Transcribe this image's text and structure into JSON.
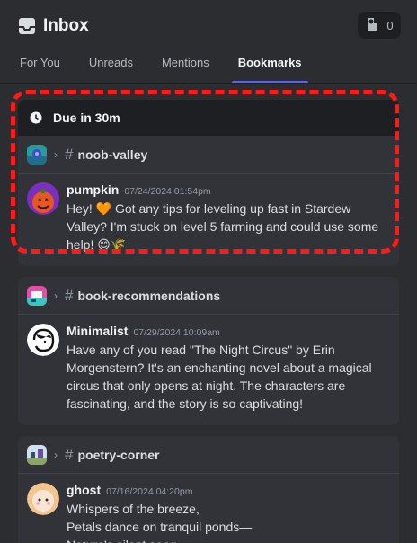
{
  "header": {
    "title": "Inbox",
    "mentions_count": "0"
  },
  "tabs": [
    {
      "label": "For You",
      "active": false
    },
    {
      "label": "Unreads",
      "active": false
    },
    {
      "label": "Mentions",
      "active": false
    },
    {
      "label": "Bookmarks",
      "active": true
    }
  ],
  "bookmarks": [
    {
      "due_label": "Due in 30m",
      "channel": "noob-valley",
      "author": "pumpkin",
      "timestamp": "07/24/2024 01:54pm",
      "text": "Hey! 🧡 Got any tips for leveling up fast in Stardew Valley? I'm stuck on level 5 farming and could use some help! 😊🌾"
    },
    {
      "channel": "book-recommendations",
      "author": "Minimalist",
      "timestamp": "07/29/2024 10:09am",
      "text": "Have any of you read \"The Night Circus\" by Erin Morgenstern? It's an enchanting novel about a magical circus that only opens at night. The characters are fascinating, and the story is so captivating!"
    },
    {
      "channel": "poetry-corner",
      "author": "ghost",
      "timestamp": "07/16/2024 04:20pm",
      "text_lines": [
        "Whispers of the breeze,",
        "Petals dance on tranquil ponds—",
        "Nature's silent song"
      ]
    }
  ],
  "icons": {
    "inbox": "inbox-icon",
    "mention": "mention-icon",
    "clock": "clock-icon",
    "chevron": "chevron-right-icon"
  },
  "colors": {
    "accent": "#5865f2",
    "highlight": "#ff1a1a"
  }
}
